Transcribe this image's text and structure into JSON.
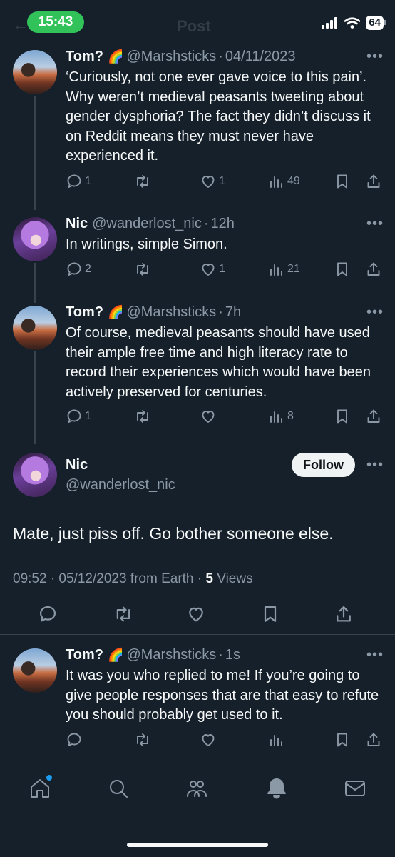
{
  "status": {
    "time": "15:43",
    "battery": "64"
  },
  "header": {
    "title": "Post",
    "back_icon": "back-arrow-icon"
  },
  "tweets": [
    {
      "name": "Tom?",
      "flag": "🌈",
      "handle": "@Marshsticks",
      "time": "04/11/2023",
      "text": "‘Curiously, not one ever gave voice to this pain’. Why weren’t medieval peasants tweeting about gender dysphoria? The fact they didn’t discuss it on Reddit means they must never have experienced it.",
      "replies": "1",
      "reposts": "",
      "likes": "1",
      "views": "49"
    },
    {
      "name": "Nic",
      "flag": "",
      "handle": "@wanderlost_nic",
      "time": "12h",
      "text": "In writings, simple Simon.",
      "replies": "2",
      "reposts": "",
      "likes": "1",
      "views": "21"
    },
    {
      "name": "Tom?",
      "flag": "🌈",
      "handle": "@Marshsticks",
      "time": "7h",
      "text": "Of course, medieval peasants should have used their ample free time and high literacy rate to record their experiences which would have been actively preserved for centuries.",
      "replies": "1",
      "reposts": "",
      "likes": "",
      "views": "8"
    }
  ],
  "main_tweet": {
    "name": "Nic",
    "handle": "@wanderlost_nic",
    "follow_label": "Follow",
    "text": "Mate, just piss off. Go bother someone else.",
    "meta": "09:52 · 05/12/2023 from Earth · ",
    "views_count": "5",
    "views_label": " Views"
  },
  "reply_tweet": {
    "name": "Tom?",
    "flag": "🌈",
    "handle": "@Marshsticks",
    "time": "1s",
    "text": "It was you who replied to me! If you’re going to give people responses that are that easy to refute you should probably get used to it.",
    "replies": "",
    "reposts": "",
    "likes": "",
    "views": ""
  },
  "nav": {
    "items": [
      "home-icon",
      "search-icon",
      "communities-icon",
      "notifications-icon",
      "messages-icon"
    ]
  },
  "colors": {
    "background": "#15202b",
    "secondary_text": "#8b98a5",
    "accent": "#1d9bf0",
    "status_green": "#31c259"
  }
}
